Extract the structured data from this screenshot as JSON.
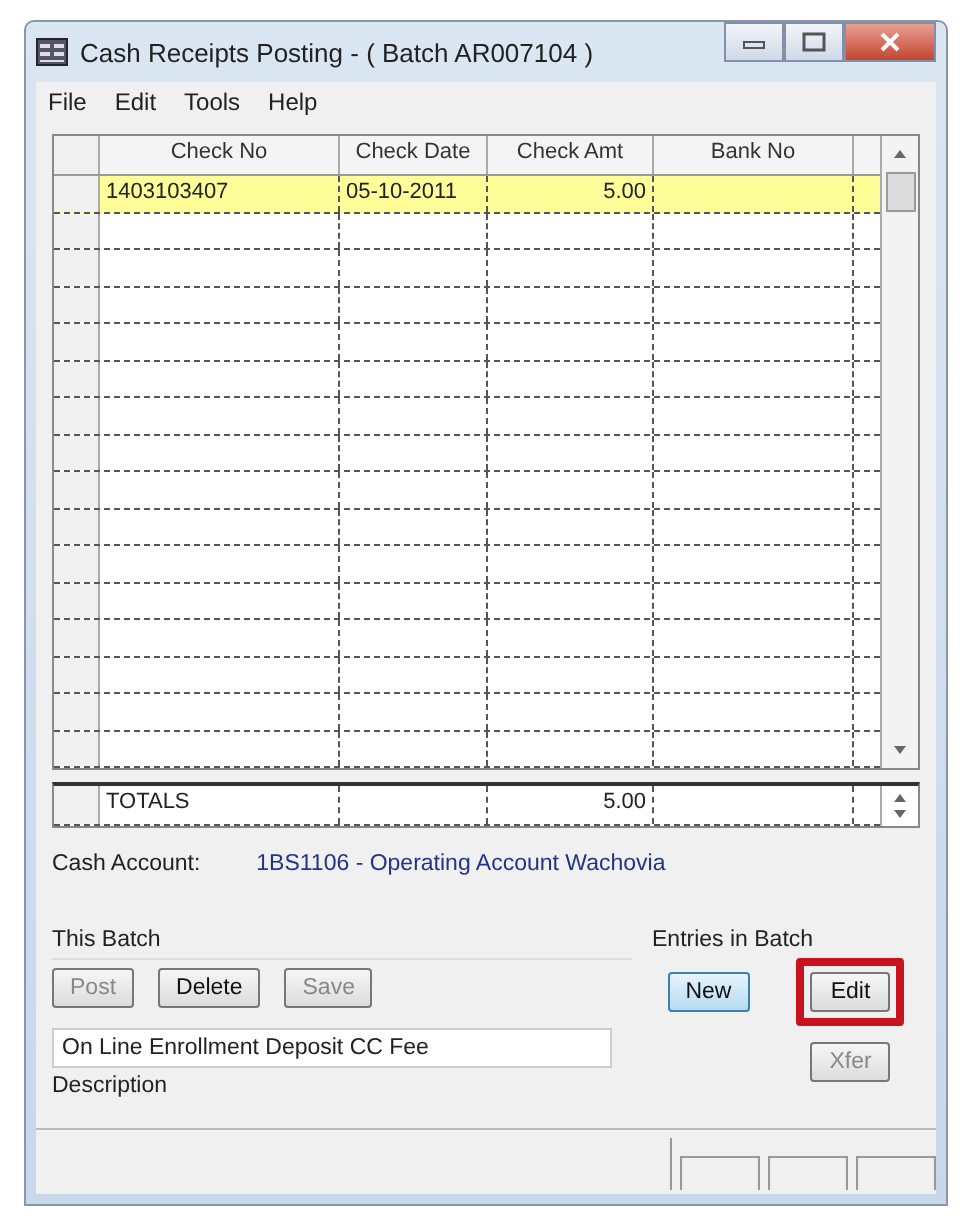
{
  "window": {
    "title": "Cash Receipts Posting - ( Batch AR007104 )"
  },
  "menu": [
    "File",
    "Edit",
    "Tools",
    "Help"
  ],
  "table": {
    "columns": [
      "Check No",
      "Check Date",
      "Check Amt",
      "Bank No"
    ],
    "rows": [
      {
        "check_no": "1403103407",
        "check_date": "05-10-2011",
        "check_amt": "5.00",
        "selected": true
      }
    ],
    "totals": {
      "label": "TOTALS",
      "check_amt": "5.00"
    }
  },
  "cash_account": {
    "label": "Cash Account:",
    "value": "1BS1106 - Operating Account Wachovia"
  },
  "this_batch": {
    "title": "This Batch",
    "buttons": [
      {
        "label": "Post",
        "disabled": true
      },
      {
        "label": "Delete",
        "disabled": false
      },
      {
        "label": "Save",
        "disabled": true
      }
    ],
    "description": {
      "value": "On Line Enrollment Deposit CC Fee",
      "label": "Description"
    }
  },
  "entries": {
    "title": "Entries in Batch",
    "buttons": [
      {
        "label": "New",
        "focused": true,
        "highlighted": false,
        "disabled": false
      },
      {
        "label": "Edit",
        "focused": false,
        "highlighted": true,
        "disabled": false
      },
      {
        "label": "Xfer",
        "focused": false,
        "highlighted": false,
        "disabled": true
      }
    ]
  }
}
